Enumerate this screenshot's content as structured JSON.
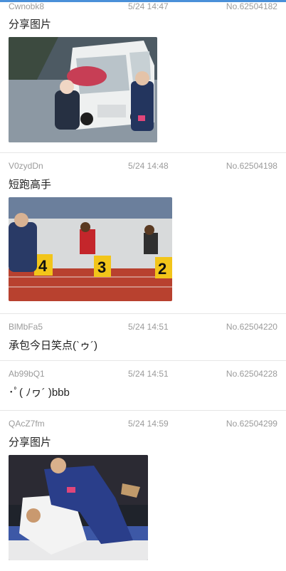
{
  "posts": [
    {
      "user": "Cwnobk8",
      "time": "5/24 14:47",
      "no": "No.62504182",
      "text": "分享图片",
      "image_icon": "car-scene-image"
    },
    {
      "user": "V0zydDn",
      "time": "5/24 14:48",
      "no": "No.62504198",
      "text": "短跑高手",
      "image_icon": "sprint-scene-image"
    },
    {
      "user": "BlMbFa5",
      "time": "5/24 14:51",
      "no": "No.62504220",
      "text": "承包今日笑点(`ゥ´)"
    },
    {
      "user": "Ab99bQ1",
      "time": "5/24 14:51",
      "no": "No.62504228",
      "text": "･ﾟ( ﾉヮ´ )bbb"
    },
    {
      "user": "QAcZ7fm",
      "time": "5/24 14:59",
      "no": "No.62504299",
      "text": "分享图片",
      "image_icon": "judo-scene-image"
    }
  ],
  "colors": {
    "accent": "#4a90d9",
    "meta_text": "#9b9b9b",
    "body_text": "#222222",
    "divider": "#e6e6e6"
  }
}
